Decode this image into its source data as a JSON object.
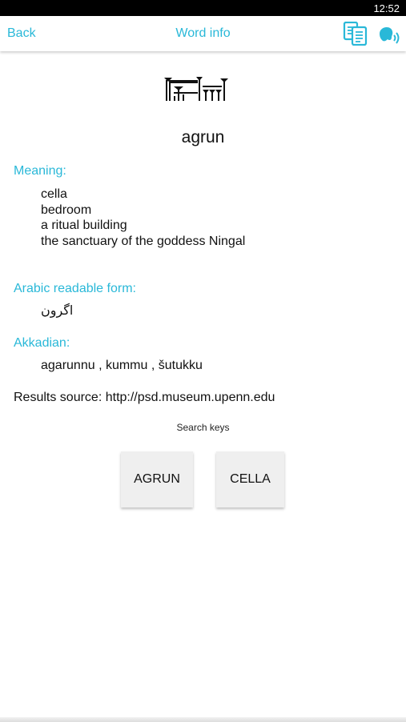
{
  "status_bar": {
    "time": "12:52"
  },
  "toolbar": {
    "back_label": "Back",
    "title": "Word info",
    "copy_icon": "copy-icon",
    "speak_icon": "speak-icon"
  },
  "word": {
    "cuneiform_icon": "cuneiform-sign-image",
    "transliteration": "agrun"
  },
  "meaning": {
    "label": "Meaning:",
    "items": [
      "cella",
      "bedroom",
      "a ritual building",
      "the sanctuary of the goddess Ningal"
    ]
  },
  "arabic": {
    "label": "Arabic readable form:",
    "value": "اگرون"
  },
  "akkadian": {
    "label": "Akkadian:",
    "value": "agarunnu , kummu , šutukku"
  },
  "source": {
    "label": "Results source:",
    "url": "http://psd.museum.upenn.edu"
  },
  "search_keys": {
    "label": "Search keys",
    "keys": [
      "AGRUN",
      "CELLA"
    ]
  },
  "colors": {
    "accent": "#29b8d8",
    "button_bg": "#efefef",
    "status_bar": "#000000"
  }
}
